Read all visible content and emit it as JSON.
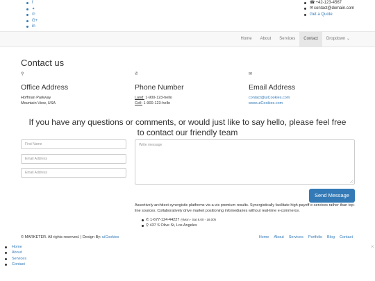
{
  "topbar": {
    "social": [
      {
        "icon": "facebook-icon",
        "glyph": "f"
      },
      {
        "icon": "twitter-icon",
        "glyph": "🐦"
      },
      {
        "icon": "pinterest-icon",
        "glyph": "℗"
      },
      {
        "icon": "google-plus-icon",
        "glyph": "G+"
      },
      {
        "icon": "linkedin-icon",
        "glyph": "in"
      }
    ],
    "phone": "+42-123-4567",
    "email": "contact@domain.com",
    "quote": "Get a Quote"
  },
  "nav": {
    "items": [
      "Home",
      "About",
      "Services",
      "Contact",
      "Dropdown ⌄"
    ],
    "active": "Contact"
  },
  "contact": {
    "heading": "Contact us",
    "office": {
      "title": "Office Address",
      "line1": "Hoffman Parkway",
      "line2": "Mountain View, USA"
    },
    "phone": {
      "title": "Phone Number",
      "land_label": "Land:",
      "land": " 1-900-123-hello",
      "cell_label": "Cell:",
      "cell": " 1-900-123-hello"
    },
    "email": {
      "title": "Email Address",
      "email": "contact@uiCookies.com",
      "web": "www.uiCookies.com"
    }
  },
  "tagline": "If you have any questions or comments, or would just like to say hello, please feel free to contact our friendly team",
  "form": {
    "first_name": "First Name",
    "email": "Email Address",
    "email2": "Email Address",
    "message": "Write message",
    "send": "Send Message"
  },
  "info": {
    "desc": "Assertively architect synergistic platforms vis-a-vis premium results. Synergistically facilitate high-payoff e-services rather than top-line sources. Collaboratively drive market positioning infomediaries without real-time e-commerce.",
    "phone": "1-677-124-44227",
    "hours": "Mon - Sat 8.00 - 18.00h",
    "address": "437 S Olive St, Los Angeles"
  },
  "footer": {
    "copyright": "© MARKETER. All rights reserved. | Design By: ",
    "designer": "uiCookies",
    "links": [
      "Home",
      "About",
      "Services",
      "Portfolio",
      "Blog",
      "Contact"
    ]
  },
  "mobile_menu": [
    "Home",
    "About",
    "Services",
    "Contact"
  ],
  "colors": {
    "link": "#337ab7",
    "navbar_bg": "#f8f8f8",
    "button": "#337ab7"
  }
}
